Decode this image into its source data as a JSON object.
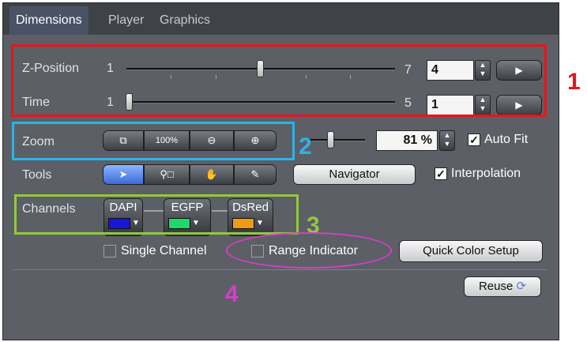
{
  "tabs": [
    {
      "label": "Dimensions"
    },
    {
      "label": "Player"
    },
    {
      "label": "Graphics"
    }
  ],
  "zposition": {
    "label": "Z-Position",
    "min": "1",
    "max": "7",
    "value": "4"
  },
  "time": {
    "label": "Time",
    "min": "1",
    "max": "5",
    "value": "1"
  },
  "zoom": {
    "label": "Zoom",
    "button_100_label": "100%",
    "percent_value": "81 %",
    "autofit_label": "Auto Fit",
    "autofit_checked": true
  },
  "tools": {
    "label": "Tools",
    "navigator_label": "Navigator",
    "interpolation_label": "Interpolation",
    "interpolation_checked": true
  },
  "channels": {
    "label": "Channels",
    "items": [
      {
        "name": "DAPI",
        "color": "#1518d6"
      },
      {
        "name": "EGFP",
        "color": "#1fd86a"
      },
      {
        "name": "DsRed",
        "color": "#f09a16"
      }
    ]
  },
  "single_channel_label": "Single Channel",
  "range_indicator_label": "Range Indicator",
  "quick_color_setup_label": "Quick Color Setup",
  "reuse_label": "Reuse",
  "annotations": {
    "n1": "1",
    "n2": "2",
    "n3": "3",
    "n4": "4",
    "colors": {
      "red": "#e8141c",
      "blue": "#2bb3e8",
      "green": "#93c83d",
      "magenta": "#d53ec9"
    }
  },
  "theme": {
    "panel": "#5c5f66",
    "tabbar": "#3f4247",
    "accent": "#4a5365"
  }
}
